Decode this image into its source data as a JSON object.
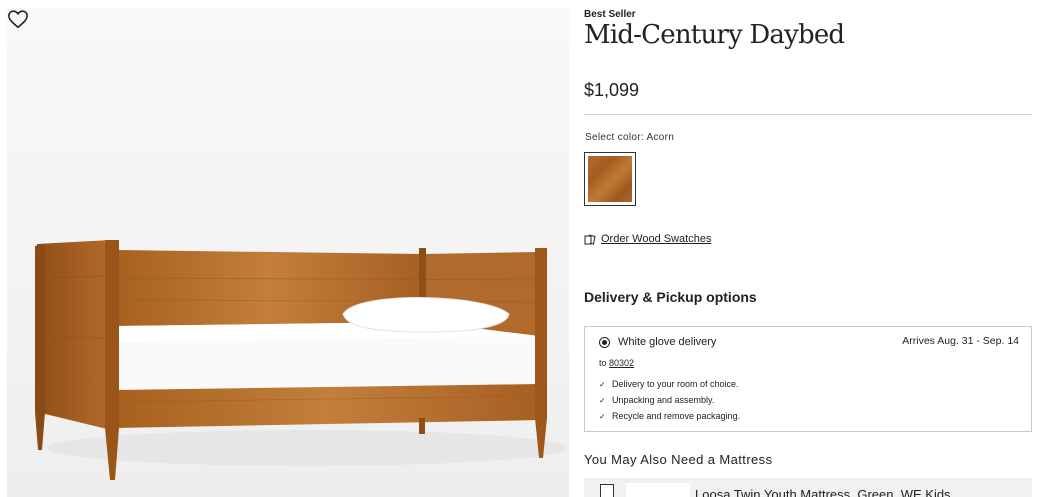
{
  "product": {
    "badge": "Best Seller",
    "title": "Mid-Century Daybed",
    "price": "$1,099",
    "image_alt_icon": "product-photo"
  },
  "color": {
    "label": "Select color:  Acorn",
    "swatch_color": "#a9642a"
  },
  "swatches_link": "Order Wood Swatches",
  "delivery": {
    "heading": "Delivery & Pickup options",
    "option_label": "White glove delivery",
    "arrives": "Arrives Aug. 31 - Sep. 14",
    "to_prefix": "to",
    "zip": "80302",
    "benefits": [
      "Delivery to your room of choice.",
      "Unpacking and assembly.",
      "Recycle and remove packaging."
    ]
  },
  "recommendations": {
    "heading": "You May Also Need a Mattress",
    "item_name": "Loosa Twin Youth Mattress, Green, WE Kids"
  }
}
